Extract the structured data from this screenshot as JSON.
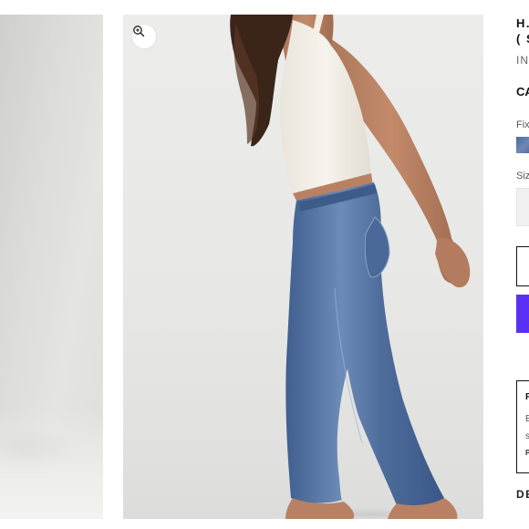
{
  "product": {
    "title_line1": "H.",
    "title_line2": "( S",
    "stock": "IN",
    "price": "CA",
    "fit_label": "Fix",
    "size_label": "Siz",
    "details": "DE"
  },
  "promo": {
    "title": "F",
    "line1": "E",
    "line2": "s",
    "line3": "P"
  },
  "gallery": {
    "zoom_icon": "zoom-in-icon"
  },
  "colors": {
    "accent_pay": "#5a31f4",
    "swatch_denim": "#5a76a6"
  }
}
